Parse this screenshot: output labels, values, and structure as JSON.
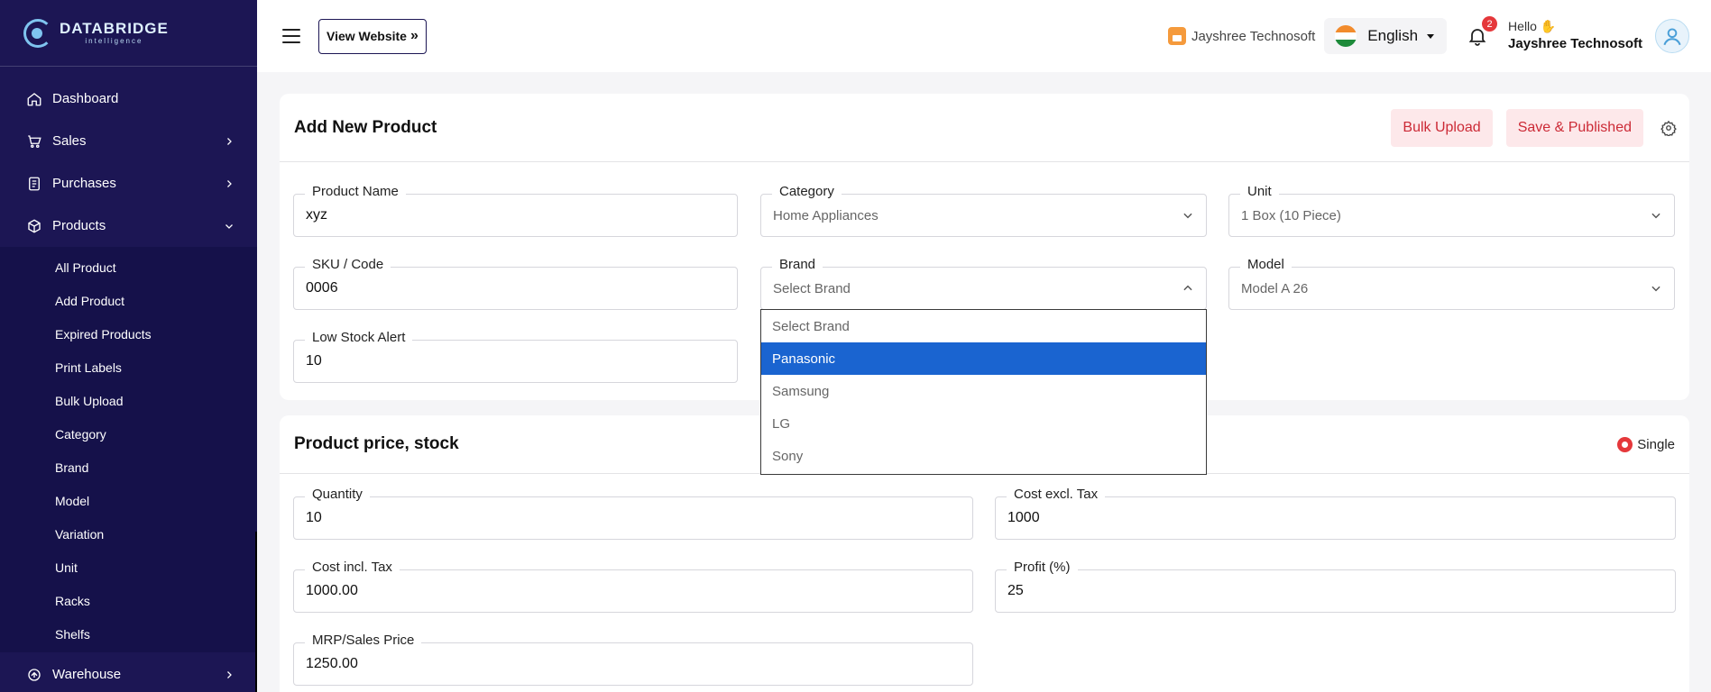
{
  "brand": {
    "title": "DATABRIDGE",
    "subtitle": "intelligence"
  },
  "sidebar": {
    "items": [
      {
        "label": "Dashboard",
        "icon": "home-icon"
      },
      {
        "label": "Sales",
        "icon": "cart-icon"
      },
      {
        "label": "Purchases",
        "icon": "receipt-icon"
      },
      {
        "label": "Products",
        "icon": "cube-icon"
      }
    ],
    "products_submenu": [
      "All Product",
      "Add Product",
      "Expired Products",
      "Print Labels",
      "Bulk Upload",
      "Category",
      "Brand",
      "Model",
      "Variation",
      "Unit",
      "Racks",
      "Shelfs"
    ],
    "warehouse": {
      "label": "Warehouse",
      "icon": "warehouse-icon"
    }
  },
  "topbar": {
    "view_website": "View Website",
    "company": "Jayshree Technosoft",
    "language": "English",
    "notification_count": "2",
    "hello": "Hello",
    "user_name": "Jayshree Technosoft"
  },
  "product_form": {
    "title": "Add New Product",
    "bulk_upload": "Bulk Upload",
    "save_published": "Save & Published",
    "fields": {
      "product_name": {
        "label": "Product Name",
        "value": "xyz"
      },
      "category": {
        "label": "Category",
        "value": "Home Appliances"
      },
      "unit": {
        "label": "Unit",
        "value": "1 Box (10 Piece)"
      },
      "sku": {
        "label": "SKU / Code",
        "value": "0006"
      },
      "brand": {
        "label": "Brand",
        "value": "Select Brand"
      },
      "model": {
        "label": "Model",
        "value": "Model A 26"
      },
      "low_stock": {
        "label": "Low Stock Alert",
        "value": "10"
      }
    },
    "brand_options": [
      "Select Brand",
      "Panasonic",
      "Samsung",
      "LG",
      "Sony"
    ],
    "brand_highlighted": "Panasonic"
  },
  "price_section": {
    "title": "Product price, stock",
    "mode": "Single",
    "fields": {
      "quantity": {
        "label": "Quantity",
        "value": "10"
      },
      "cost_excl": {
        "label": "Cost excl. Tax",
        "value": "1000"
      },
      "cost_incl": {
        "label": "Cost incl. Tax",
        "value": "1000.00"
      },
      "profit": {
        "label": "Profit (%)",
        "value": "25"
      },
      "mrp": {
        "label": "MRP/Sales Price",
        "value": "1250.00"
      }
    }
  },
  "colors": {
    "sidebar": "#1c1654",
    "accent_red": "#cc2a36",
    "soft_red": "#fde8ea",
    "selected_blue": "#1a64d0"
  }
}
